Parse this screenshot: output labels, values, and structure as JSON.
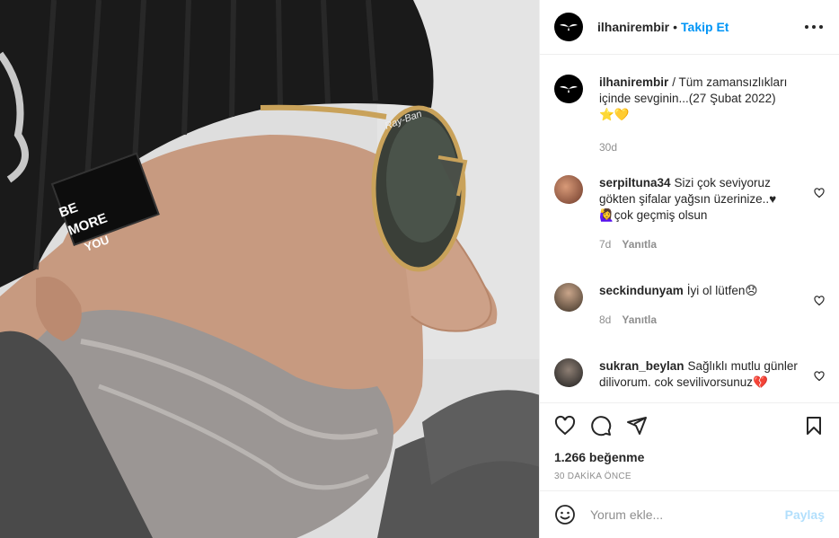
{
  "post": {
    "username": "ilhanirembir",
    "follow_label": "Takip Et",
    "separator": "•",
    "photo_patch_text": [
      "BE",
      "MORE",
      "YOU"
    ],
    "photo_glasses_brand": "Ray-Ban"
  },
  "caption": {
    "username": "ilhanirembir",
    "text": "/ Tüm zamansızlıkları içinde sevginin...(27 Şubat 2022)",
    "emojis": "⭐💛",
    "age": "30d"
  },
  "comments": [
    {
      "username": "serpiltuna34",
      "text": "Sizi çok seviyoruz gökten şifalar yağsın üzerinize..♥",
      "text2": "🙋‍♀️çok geçmiş olsun",
      "age": "7d",
      "reply_label": "Yanıtla",
      "avatar_color": "#b36a4a"
    },
    {
      "username": "seckindunyam",
      "text": "İyi ol lütfen😞",
      "age": "8d",
      "reply_label": "Yanıtla",
      "avatar_color": "#6b5a46"
    },
    {
      "username": "sukran_beylan",
      "text": "Sağlıklı mutlu günler dilivorum. cok sevilivorsunuz💔",
      "avatar_color": "#3b3b3b"
    }
  ],
  "actions": {
    "likes": "1.266 beğenme",
    "time": "30 DAKİKA ÖNCE"
  },
  "add_comment": {
    "placeholder": "Yorum ekle...",
    "post_label": "Paylaş"
  },
  "colors": {
    "link": "#0095f6",
    "muted": "#8e8e8e",
    "post_disabled": "#b2dffc"
  }
}
